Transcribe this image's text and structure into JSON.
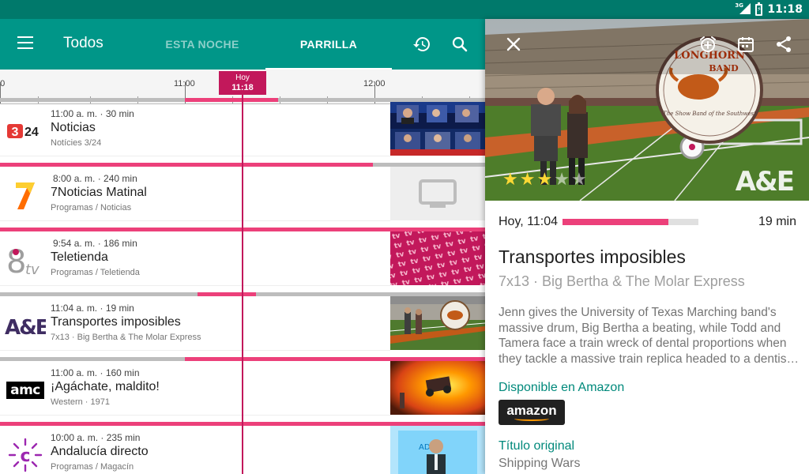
{
  "statusbar": {
    "network": "3G",
    "time": "11:18"
  },
  "appbar": {
    "title": "Todos",
    "tabs": [
      "ESTA NOCHE",
      "PARRILLA"
    ],
    "active_tab": "PARRILLA"
  },
  "timeline": {
    "labels": [
      "11:00",
      "12:00"
    ],
    "now_label": "Hoy",
    "now_time": "11:18"
  },
  "channels": [
    {
      "logo": "3/24",
      "time": "11:00 a. m.",
      "duration": "30 min",
      "title": "Noticias",
      "subtitle": "Notícies 3/24"
    },
    {
      "logo": "7",
      "time": "8:00 a. m.",
      "duration": "240 min",
      "title": "7Noticias Matinal",
      "subtitle": "Programas / Noticias"
    },
    {
      "logo": "8tv",
      "time": "9:54 a. m.",
      "duration": "186 min",
      "title": "Teletienda",
      "subtitle": "Programas / Teletienda"
    },
    {
      "logo": "A&E",
      "time": "11:04 a. m.",
      "duration": "19 min",
      "title": "Transportes imposibles",
      "subtitle": "7x13 · Big Bertha & The Molar Express"
    },
    {
      "logo": "amc",
      "time": "11:00 a. m.",
      "duration": "160 min",
      "title": "¡Agáchate, maldito!",
      "subtitle": "Western · 1971"
    },
    {
      "logo": "canal-sur",
      "time": "10:00 a. m.",
      "duration": "235 min",
      "title": "Andalucía directo",
      "subtitle": "Programas / Magacín"
    }
  ],
  "detail": {
    "rating_stars": 3,
    "rating_max": 5,
    "channel_logo": "A&E",
    "when": "Hoy, 11:04",
    "progress": 0.78,
    "remaining": "19 min",
    "title": "Transportes imposibles",
    "episode": "7x13 · Big Bertha & The Molar Express",
    "description": "Jenn gives the University of Texas Marching band's massive drum, Big Bertha a beating, while Todd and Tamera face a train wreck of dental proportions when they tackle a massive train replica headed to a dentist's office.",
    "available_label": "Disponible en Amazon",
    "amazon_label": "amazon",
    "original_title_label": "Título original",
    "original_title": "Shipping Wars",
    "hero_text": [
      "LONGHORN",
      "BAND",
      "The Show Band of the Southwest"
    ]
  },
  "colors": {
    "primary": "#009688",
    "primary_dark": "#00796b",
    "accent": "#c2185b",
    "progress": "#ec407a"
  }
}
